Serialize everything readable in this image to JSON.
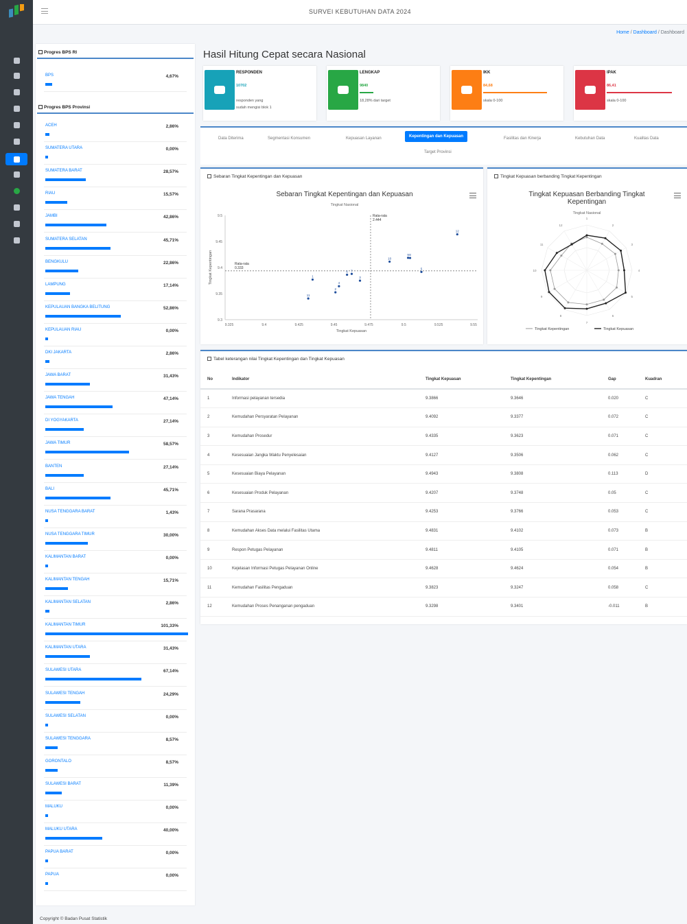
{
  "app": {
    "title": "SURVEI KEBUTUHAN DATA 2024"
  },
  "breadcrumb": {
    "home": "Home",
    "sep": "/",
    "section": "Dashboard",
    "current": "Dashboard"
  },
  "sidebar_icons": [
    "logo-icon",
    "tachometer-icon",
    "home-icon",
    "book-icon",
    "chart-icon",
    "file-icon",
    "table-icon",
    "user-icon",
    "flag-icon",
    "circle-icon",
    "file-alt-icon",
    "folder-icon",
    "sign-out-icon"
  ],
  "progress_ri": {
    "heading": "Progres BPS RI",
    "items": [
      {
        "name": "BPS",
        "percent": "4,67%",
        "value": 4.67
      }
    ]
  },
  "progress_prov": {
    "heading": "Progres BPS Provinsi",
    "items": [
      {
        "name": "ACEH",
        "percent": "2,86%",
        "value": 2.86
      },
      {
        "name": "SUMATERA UTARA",
        "percent": "0,00%",
        "value": 0
      },
      {
        "name": "SUMATERA BARAT",
        "percent": "28,57%",
        "value": 28.57
      },
      {
        "name": "RIAU",
        "percent": "15,57%",
        "value": 15.57
      },
      {
        "name": "JAMBI",
        "percent": "42,86%",
        "value": 42.86
      },
      {
        "name": "SUMATERA SELATAN",
        "percent": "45,71%",
        "value": 45.71
      },
      {
        "name": "BENGKULU",
        "percent": "22,86%",
        "value": 22.86
      },
      {
        "name": "LAMPUNG",
        "percent": "17,14%",
        "value": 17.14
      },
      {
        "name": "KEPULAUAN BANGKA BELITUNG",
        "percent": "52,86%",
        "value": 52.86
      },
      {
        "name": "KEPULAUAN RIAU",
        "percent": "0,00%",
        "value": 0
      },
      {
        "name": "DKI JAKARTA",
        "percent": "2,86%",
        "value": 2.86
      },
      {
        "name": "JAWA BARAT",
        "percent": "31,43%",
        "value": 31.43
      },
      {
        "name": "JAWA TENGAH",
        "percent": "47,14%",
        "value": 47.14
      },
      {
        "name": "DI YOGYAKARTA",
        "percent": "27,14%",
        "value": 27.14
      },
      {
        "name": "JAWA TIMUR",
        "percent": "58,57%",
        "value": 58.57
      },
      {
        "name": "BANTEN",
        "percent": "27,14%",
        "value": 27.14
      },
      {
        "name": "BALI",
        "percent": "45,71%",
        "value": 45.71
      },
      {
        "name": "NUSA TENGGARA BARAT",
        "percent": "1,43%",
        "value": 1.43
      },
      {
        "name": "NUSA TENGGARA TIMUR",
        "percent": "30,00%",
        "value": 30.0
      },
      {
        "name": "KALIMANTAN BARAT",
        "percent": "0,00%",
        "value": 0
      },
      {
        "name": "KALIMANTAN TENGAH",
        "percent": "15,71%",
        "value": 15.71
      },
      {
        "name": "KALIMANTAN SELATAN",
        "percent": "2,86%",
        "value": 2.86
      },
      {
        "name": "KALIMANTAN TIMUR",
        "percent": "101,33%",
        "value": 101.33
      },
      {
        "name": "KALIMANTAN UTARA",
        "percent": "31,43%",
        "value": 31.43
      },
      {
        "name": "SULAWESI UTARA",
        "percent": "67,14%",
        "value": 67.14
      },
      {
        "name": "SULAWESI TENGAH",
        "percent": "24,29%",
        "value": 24.29
      },
      {
        "name": "SULAWESI SELATAN",
        "percent": "0,00%",
        "value": 0
      },
      {
        "name": "SULAWESI TENGGARA",
        "percent": "8,57%",
        "value": 8.57
      },
      {
        "name": "GORONTALO",
        "percent": "8,57%",
        "value": 8.57
      },
      {
        "name": "SULAWESI BARAT",
        "percent": "11,39%",
        "value": 11.39
      },
      {
        "name": "MALUKU",
        "percent": "0,00%",
        "value": 0
      },
      {
        "name": "MALUKU UTARA",
        "percent": "40,00%",
        "value": 40.0
      },
      {
        "name": "PAPUA BARAT",
        "percent": "0,00%",
        "value": 0
      },
      {
        "name": "PAPUA",
        "percent": "0,00%",
        "value": 0
      }
    ]
  },
  "main_title": "Hasil Hitung Cepat secara Nasional",
  "info_boxes": [
    {
      "label": "RESPONDEN",
      "value": "10702",
      "desc1": "responden yang",
      "desc2": "sudah mengisi blok 1",
      "color": "#17a2b8",
      "icon": "users-icon",
      "progress": 0
    },
    {
      "label": "LENGKAP",
      "value": "9840",
      "desc1": "18,28% dari target",
      "desc2": "",
      "color": "#28a745",
      "icon": "check-circle-icon",
      "progress": 18.28
    },
    {
      "label": "IKK",
      "value": "84,68",
      "desc1": "skala 0-100",
      "desc2": "",
      "color": "#fd7e14",
      "icon": "chart-area-icon",
      "progress": 84.68
    },
    {
      "label": "IPAK",
      "value": "86,41",
      "desc1": "skala 0-100",
      "desc2": "",
      "color": "#dc3545",
      "icon": "chart-bar-icon",
      "progress": 86.41
    }
  ],
  "tabs": [
    {
      "label": "Data Diterima",
      "active": false
    },
    {
      "label": "Segmentasi Konsumen",
      "active": false
    },
    {
      "label": "Kepuasan Layanan",
      "active": false
    },
    {
      "label": "Kepentingan dan Kepuasan",
      "active": true
    },
    {
      "label": "Fasilitas dan Kinerja",
      "active": false
    },
    {
      "label": "Kebutuhan Data",
      "active": false
    },
    {
      "label": "Kualitas Data",
      "active": false
    },
    {
      "label": "Target Provinsi",
      "active": false
    }
  ],
  "scatter_card": {
    "header": "Sebaran Tingkat Kepentingan dan Kepuasan",
    "title": "Sebaran Tingkat Kepentingan dan Kepuasan",
    "subtitle": "Tingkat Nasional",
    "xlabel": "Tingkat Kepuasan",
    "ylabel": "Tingkat Kepentingan",
    "mean_x_label": "Rata-rata",
    "mean_x_value": "2.444",
    "mean_y_label": "Rata-rata",
    "mean_y_value": "0.333"
  },
  "radar_card": {
    "header": "Tingkat Kepuasan berbanding Tingkat Kepentingan",
    "title_line1": "Tingkat Kepuasan Berbanding Tingkat",
    "title_line2": "Kepentingan",
    "subtitle": "Tingkat Nasional",
    "legend_a": "Tingkat Kepentingan",
    "legend_b": "Tingkat Kepuasan"
  },
  "table_card": {
    "header": "Tabel keterangan nilai Tingkat Kepentingan dan Tingkat Kepuasan",
    "columns": [
      "No",
      "Indikator",
      "Tingkat Kepuasan",
      "Tingkat Kepentingan",
      "Gap",
      "Kuadran"
    ],
    "rows": [
      [
        "1",
        "Informasi pelayanan tersedia",
        "9.3866",
        "9.3646",
        "0.020",
        "C"
      ],
      [
        "2",
        "Kemudahan Persyaratan Pelayanan",
        "9.4092",
        "9.3377",
        "0.072",
        "C"
      ],
      [
        "3",
        "Kemudahan Prosedur",
        "9.4335",
        "9.3623",
        "0.071",
        "C"
      ],
      [
        "4",
        "Kesesuaian Jangka Waktu Penyelesaian",
        "9.4127",
        "9.3506",
        "0.062",
        "C"
      ],
      [
        "5",
        "Kesesuaian Biaya Pelayanan",
        "9.4943",
        "9.3808",
        "0.113",
        "D"
      ],
      [
        "6",
        "Kesesuaian Produk Pelayanan",
        "9.4207",
        "9.3748",
        "0.05",
        "C"
      ],
      [
        "7",
        "Sarana Prasarana",
        "9.4253",
        "9.3766",
        "0.053",
        "C"
      ],
      [
        "8",
        "Kemudahan Akses Data melalui Fasilitas Utama",
        "9.4831",
        "9.4102",
        "0.073",
        "B"
      ],
      [
        "9",
        "Respon Petugas Pelayanan",
        "9.4811",
        "9.4105",
        "0.071",
        "B"
      ],
      [
        "10",
        "Kejelasan Informasi Petugas Pelayanan Online",
        "9.4628",
        "9.4624",
        "0.054",
        "B"
      ],
      [
        "11",
        "Kemudahan Fasilitas Pengaduan",
        "9.3823",
        "9.3247",
        "0.058",
        "C"
      ],
      [
        "12",
        "Kemudahan Proses Penanganan pengaduan",
        "9.3298",
        "9.3401",
        "-0.011",
        "B"
      ]
    ]
  },
  "chart_data": [
    {
      "type": "scatter",
      "title": "Sebaran Tingkat Kepentingan dan Kepuasan",
      "subtitle": "Tingkat Nasional",
      "xlabel": "Tingkat Kepuasan",
      "ylabel": "Tingkat Kepentingan",
      "xlim": [
        9.3,
        9.55
      ],
      "ylim": [
        9.28,
        9.5
      ],
      "x_ticks": [
        "9.325",
        "9.4",
        "9.425",
        "9.45",
        "9.475",
        "9.5",
        "9.525",
        "9.55"
      ],
      "y_ticks": [
        "9.5",
        "9.45",
        "9.4",
        "9.35",
        "9.3"
      ],
      "points": [
        {
          "label": "1",
          "x": 9.3866,
          "y": 9.3646
        },
        {
          "label": "2",
          "x": 9.4092,
          "y": 9.3377
        },
        {
          "label": "3",
          "x": 9.4335,
          "y": 9.3623
        },
        {
          "label": "4",
          "x": 9.4127,
          "y": 9.3506
        },
        {
          "label": "5",
          "x": 9.4943,
          "y": 9.3808
        },
        {
          "label": "6",
          "x": 9.4207,
          "y": 9.3748
        },
        {
          "label": "7",
          "x": 9.4253,
          "y": 9.3766
        },
        {
          "label": "8",
          "x": 9.4831,
          "y": 9.4102
        },
        {
          "label": "9",
          "x": 9.4811,
          "y": 9.4105
        },
        {
          "label": "10",
          "x": 9.4628,
          "y": 9.4024
        },
        {
          "label": "11",
          "x": 9.3823,
          "y": 9.3247
        },
        {
          "label": "12",
          "x": 9.5298,
          "y": 9.4601
        }
      ],
      "mean_x": 9.444,
      "mean_y": 9.383,
      "grid": false
    },
    {
      "type": "radar",
      "title": "Tingkat Kepuasan Berbanding Tingkat Kepentingan",
      "subtitle": "Tingkat Nasional",
      "categories": [
        "1",
        "2",
        "3",
        "4",
        "5",
        "6",
        "7",
        "8",
        "9",
        "10",
        "11",
        "12"
      ],
      "series": [
        {
          "name": "Tingkat Kepentingan",
          "values": [
            9.3646,
            9.3377,
            9.3623,
            9.3506,
            9.3808,
            9.3748,
            9.3766,
            9.4102,
            9.4105,
            9.4024,
            9.3247,
            9.3401
          ]
        },
        {
          "name": "Tingkat Kepuasan",
          "values": [
            9.3866,
            9.4092,
            9.4335,
            9.4127,
            9.4943,
            9.4207,
            9.4253,
            9.4831,
            9.4811,
            9.4628,
            9.3823,
            9.3298
          ]
        }
      ],
      "legend": "bottom"
    }
  ],
  "footer": {
    "text": "Copyright © Badan Pusat Statistik"
  }
}
